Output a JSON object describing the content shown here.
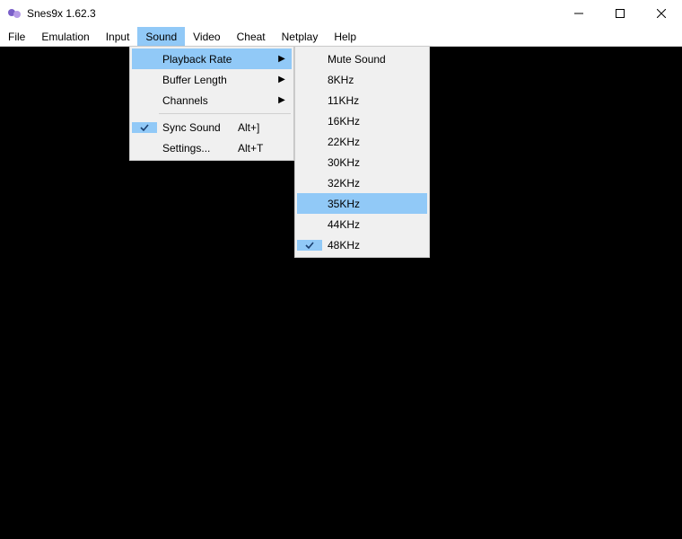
{
  "window": {
    "title": "Snes9x 1.62.3"
  },
  "menubar": {
    "items": [
      {
        "label": "File"
      },
      {
        "label": "Emulation"
      },
      {
        "label": "Input"
      },
      {
        "label": "Sound",
        "active": true
      },
      {
        "label": "Video"
      },
      {
        "label": "Cheat"
      },
      {
        "label": "Netplay"
      },
      {
        "label": "Help"
      }
    ]
  },
  "sound_menu": {
    "items": [
      {
        "label": "Playback Rate",
        "submenu": true,
        "highlight": true
      },
      {
        "label": "Buffer Length",
        "submenu": true
      },
      {
        "label": "Channels",
        "submenu": true
      },
      {
        "separator": true
      },
      {
        "label": "Sync Sound",
        "checked": true,
        "accel": "Alt+]"
      },
      {
        "label": "Settings...",
        "accel": "Alt+T"
      }
    ]
  },
  "rate_menu": {
    "items": [
      {
        "label": "Mute Sound"
      },
      {
        "label": "8KHz"
      },
      {
        "label": "11KHz"
      },
      {
        "label": "16KHz"
      },
      {
        "label": "22KHz"
      },
      {
        "label": "30KHz"
      },
      {
        "label": "32KHz"
      },
      {
        "label": "35KHz",
        "highlight": true
      },
      {
        "label": "44KHz"
      },
      {
        "label": "48KHz",
        "checked": true
      }
    ]
  }
}
